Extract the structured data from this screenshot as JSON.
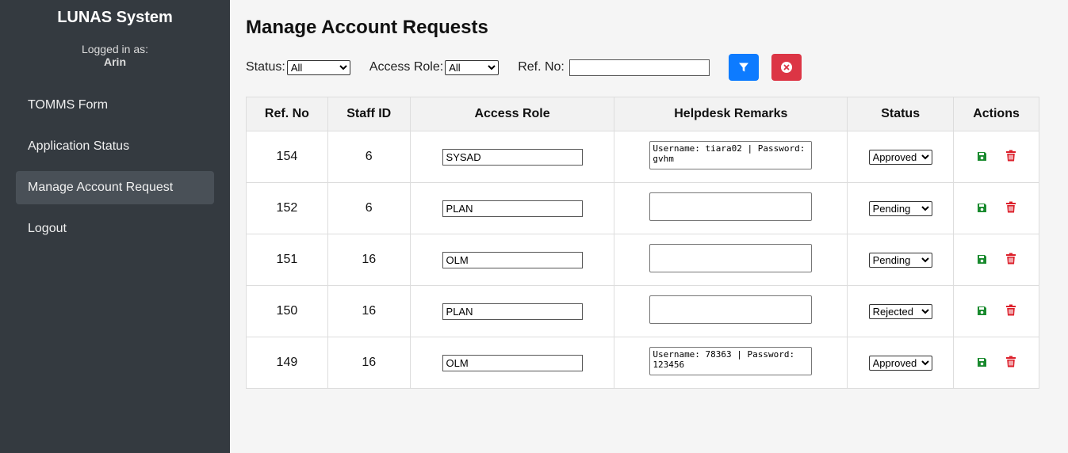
{
  "sidebar": {
    "brand": "LUNAS System",
    "logged_in_label": "Logged in as:",
    "user_name": "Arin",
    "items": [
      {
        "label": "TOMMS Form"
      },
      {
        "label": "Application Status"
      },
      {
        "label": "Manage Account Request",
        "active": true
      },
      {
        "label": "Logout"
      }
    ]
  },
  "main": {
    "title": "Manage Account Requests",
    "filters": {
      "status_label": "Status:",
      "status_value": "All",
      "role_label": "Access Role:",
      "role_value": "All",
      "ref_label": "Ref. No:",
      "ref_value": ""
    },
    "table": {
      "headers": [
        "Ref. No",
        "Staff ID",
        "Access Role",
        "Helpdesk Remarks",
        "Status",
        "Actions"
      ],
      "rows": [
        {
          "ref": "154",
          "staff": "6",
          "role": "SYSAD",
          "remarks": "Username: tiara02 | Password: gvhm",
          "status": "Approved"
        },
        {
          "ref": "152",
          "staff": "6",
          "role": "PLAN",
          "remarks": "",
          "status": "Pending"
        },
        {
          "ref": "151",
          "staff": "16",
          "role": "OLM",
          "remarks": "",
          "status": "Pending"
        },
        {
          "ref": "150",
          "staff": "16",
          "role": "PLAN",
          "remarks": "",
          "status": "Rejected"
        },
        {
          "ref": "149",
          "staff": "16",
          "role": "OLM",
          "remarks": "Username: 78363 | Password: 123456",
          "status": "Approved"
        }
      ]
    }
  },
  "colors": {
    "sidebar_bg": "#343a40",
    "active_item_bg": "#495057",
    "filter_button": "#0d7bff",
    "clear_button": "#dc3545",
    "save_icon": "#198a2e",
    "delete_icon": "#dc1f2a"
  },
  "icons": {
    "filter": "funnel-icon",
    "clear": "x-circle-icon",
    "save": "floppy-disk-icon",
    "delete": "trash-icon"
  }
}
